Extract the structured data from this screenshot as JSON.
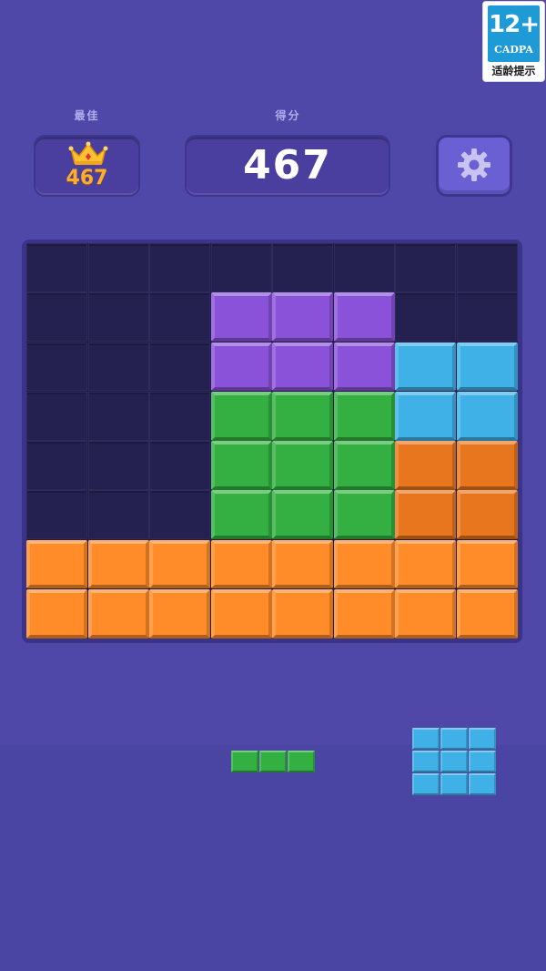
{
  "rating_badge": {
    "age": "12+",
    "org": "CADPA",
    "tip": "适龄提示"
  },
  "header": {
    "best_label": "最佳",
    "score_label": "得分",
    "best_score": "467",
    "current_score": "467",
    "best_icon": "crown-icon",
    "settings_icon": "gear-icon"
  },
  "colors": {
    "purple": "#8a52d8",
    "green": "#33b041",
    "blue": "#3fb1e6",
    "orange": "#ff8c28",
    "dark_orange": "#e8761e",
    "empty": "#24204f",
    "accent_gold": "#ffae2c"
  },
  "board": {
    "cols": 8,
    "rows": 8,
    "grid": [
      [
        "e",
        "e",
        "e",
        "e",
        "e",
        "e",
        "e",
        "e"
      ],
      [
        "e",
        "e",
        "e",
        "p",
        "p",
        "p",
        "e",
        "e"
      ],
      [
        "e",
        "e",
        "e",
        "p",
        "p",
        "p",
        "b",
        "b"
      ],
      [
        "e",
        "e",
        "e",
        "g",
        "g",
        "g",
        "b",
        "b"
      ],
      [
        "e",
        "e",
        "e",
        "g",
        "g",
        "g",
        "d",
        "d"
      ],
      [
        "e",
        "e",
        "e",
        "g",
        "g",
        "g",
        "d",
        "d"
      ],
      [
        "o",
        "o",
        "o",
        "o",
        "o",
        "o",
        "o",
        "o"
      ],
      [
        "o",
        "o",
        "o",
        "o",
        "o",
        "o",
        "o",
        "o"
      ]
    ]
  },
  "tray": {
    "pieces": [
      {
        "name": "green-line-piece",
        "color": "green",
        "shape": [
          [
            1,
            1,
            1
          ]
        ]
      },
      {
        "name": "blue-square-piece",
        "color": "blue",
        "shape": [
          [
            1,
            1,
            1
          ],
          [
            1,
            1,
            1
          ],
          [
            1,
            1,
            1
          ]
        ]
      }
    ]
  }
}
